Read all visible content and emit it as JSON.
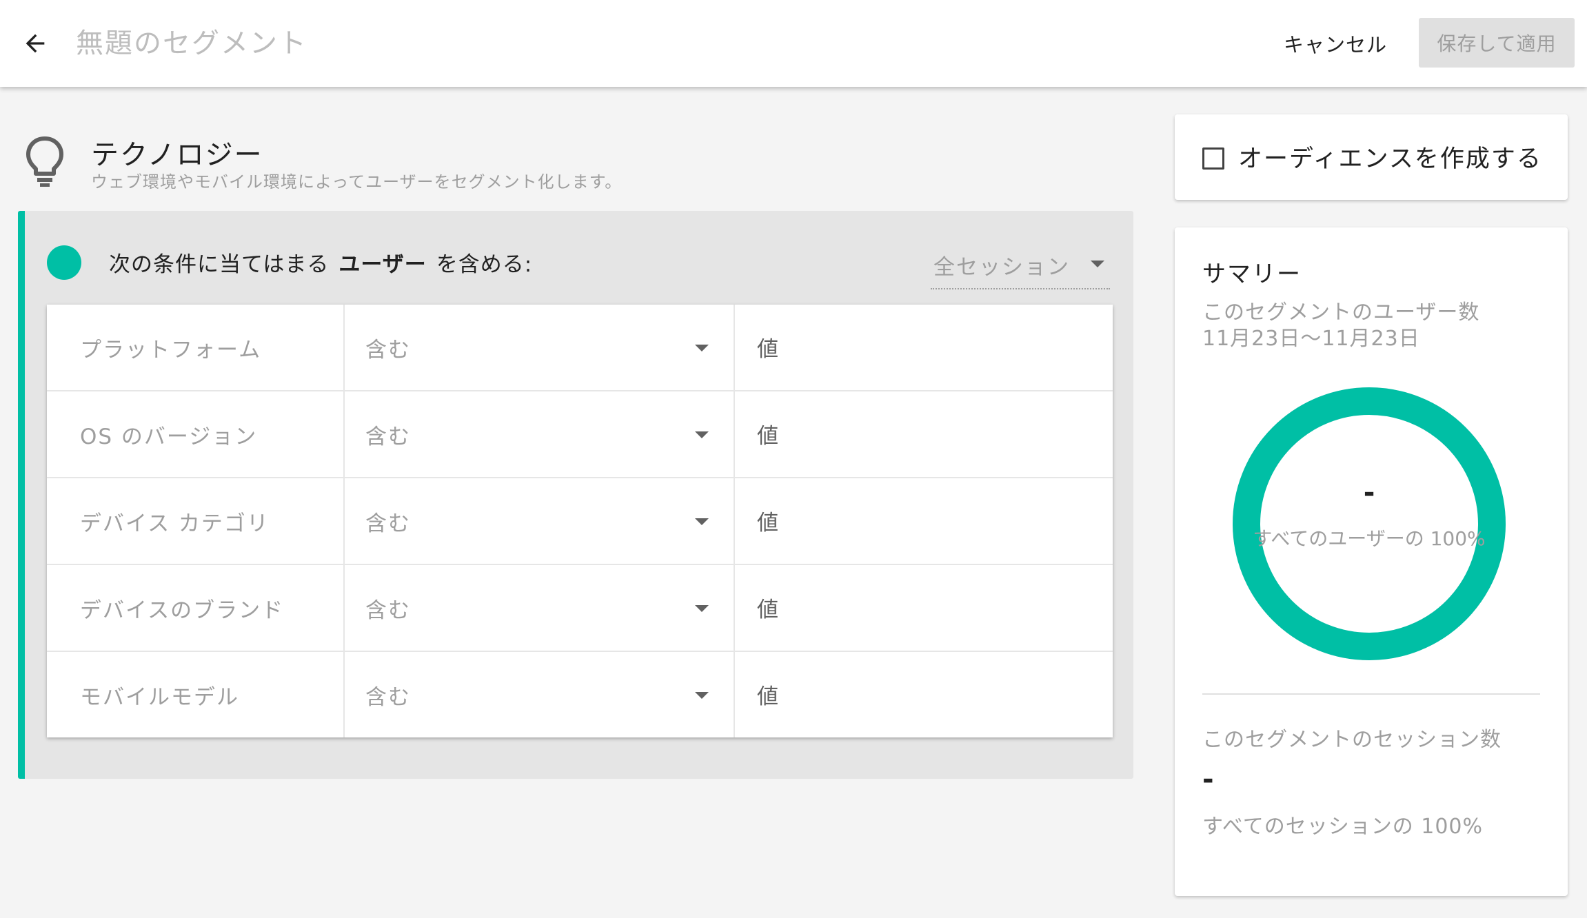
{
  "header": {
    "back_icon": "arrow-left-icon",
    "title_placeholder": "無題のセグメント",
    "cancel_label": "キャンセル",
    "save_label": "保存して適用"
  },
  "section": {
    "icon": "lightbulb-icon",
    "title": "テクノロジー",
    "description": "ウェブ環境やモバイル環境によってユーザーをセグメント化します。"
  },
  "condition": {
    "accent_color": "#00bfa5",
    "prefix": "次の条件に当てはまる",
    "target": "ユーザー",
    "suffix": "を含める:",
    "scope": "全セッション",
    "rows": [
      {
        "dimension": "プラットフォーム",
        "operator": "含む",
        "value_placeholder": "値"
      },
      {
        "dimension": "OS のバージョン",
        "operator": "含む",
        "value_placeholder": "値"
      },
      {
        "dimension": "デバイス カテゴリ",
        "operator": "含む",
        "value_placeholder": "値"
      },
      {
        "dimension": "デバイスのブランド",
        "operator": "含む",
        "value_placeholder": "値"
      },
      {
        "dimension": "モバイルモデル",
        "operator": "含む",
        "value_placeholder": "値"
      }
    ]
  },
  "audience": {
    "label": "オーディエンスを作成する",
    "checked": false
  },
  "summary": {
    "title": "サマリー",
    "users_label": "このセグメントのユーザー数",
    "date_range": "11月23日〜11月23日",
    "users_value": "-",
    "users_percent_label": "すべてのユーザーの 100%",
    "users_fraction": 1.0,
    "sessions_label": "このセグメントのセッション数",
    "sessions_value": "-",
    "sessions_percent_label": "すべてのセッションの 100%",
    "donut_color": "#00bfa5"
  }
}
